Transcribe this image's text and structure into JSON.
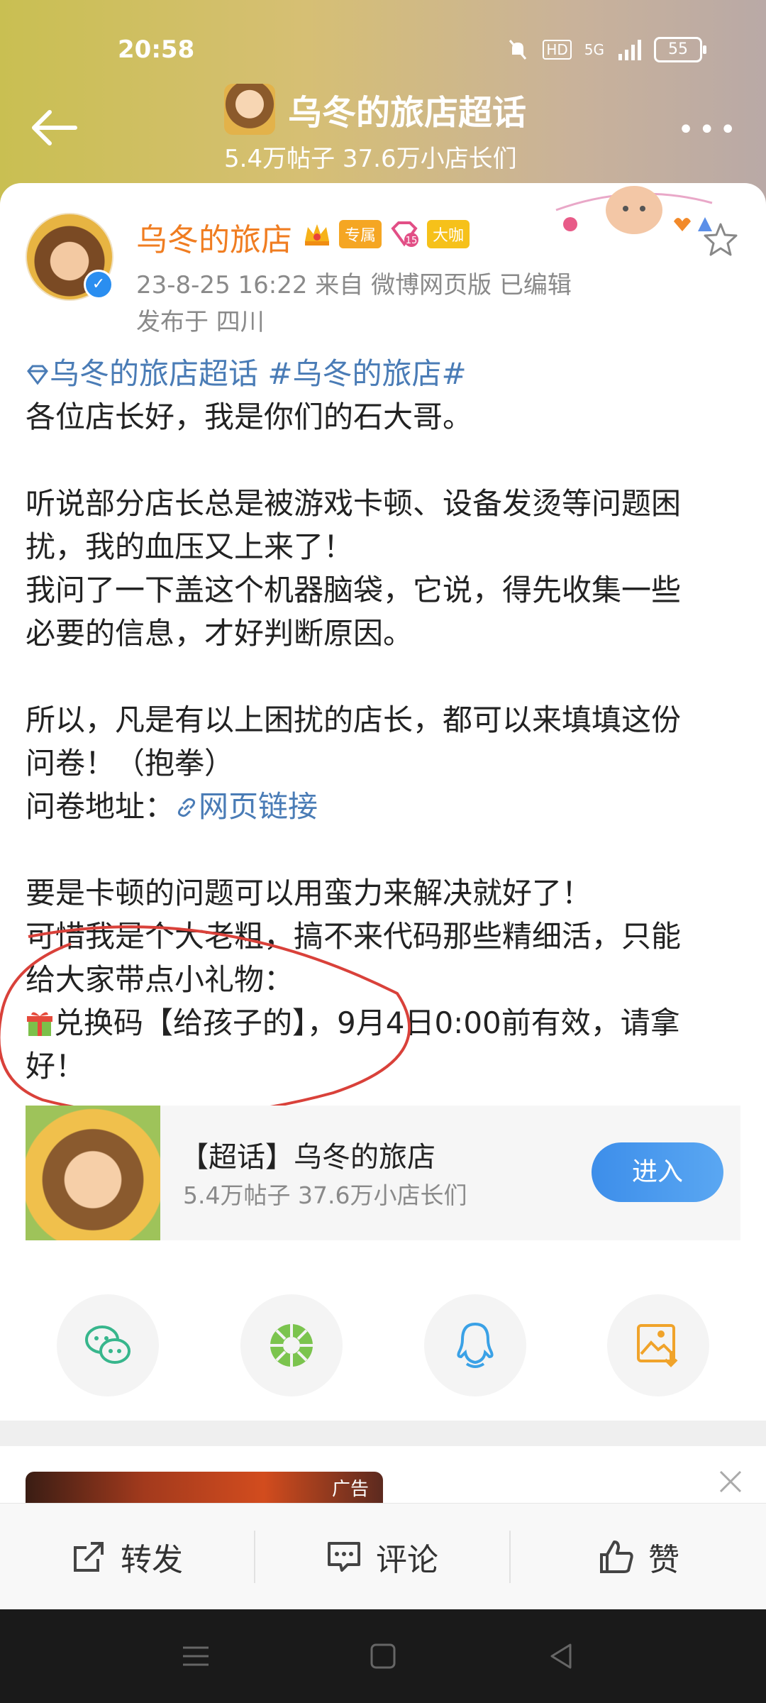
{
  "status_bar": {
    "time": "20:58",
    "battery": "55",
    "network": "5G",
    "hd": "HD"
  },
  "header": {
    "title": "乌冬的旅店超话",
    "subtitle": "5.4万帖子 37.6万小店长们",
    "more_label": "•••"
  },
  "author": {
    "name": "乌冬的旅店",
    "badges": [
      "专属",
      "大咖"
    ],
    "level": "15",
    "meta_line1": "23-8-25 16:22  来自 微博网页版  已编辑",
    "meta_line2": "发布于 四川"
  },
  "post": {
    "tags": "乌冬的旅店超话 #乌冬的旅店#",
    "lines": [
      "各位店长好，我是你们的石大哥。",
      "",
      "听说部分店长总是被游戏卡顿、设备发烫等问题困",
      "扰，我的血压又上来了！",
      "我问了一下盖这个机器脑袋，它说，得先收集一些",
      "必要的信息，才好判断原因。",
      "",
      "所以，凡是有以上困扰的店长，都可以来填填这份",
      "问卷！（抱拳）"
    ],
    "survey_prefix": "问卷地址：",
    "survey_link": "网页链接",
    "lines2": [
      "",
      "要是卡顿的问题可以用蛮力来解决就好了！",
      "可惜我是个大老粗，搞不来代码那些精细活，只能",
      "给大家带点小礼物："
    ],
    "code_line": "兑换码【给孩子的】，9月4日0:00前有效，请拿",
    "code_line_end": "好！"
  },
  "topic_card": {
    "name": "【超话】乌冬的旅店",
    "stats": "5.4万帖子 37.6万小店长们",
    "enter_label": "进入"
  },
  "share": [
    "wechat-icon",
    "moments-icon",
    "qq-icon",
    "save-image-icon"
  ],
  "ad": {
    "label": "广告"
  },
  "actions": {
    "repost": "转发",
    "comment": "评论",
    "like": "赞"
  },
  "colors": {
    "accent_orange": "#f07d21",
    "link_blue": "#4a7cb6",
    "enter_blue": "#3d8eea",
    "annotation_red": "#d9413a"
  }
}
